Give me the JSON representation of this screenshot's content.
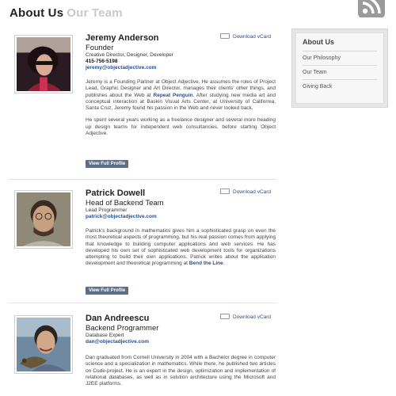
{
  "title": {
    "active": "About Us",
    "inactive": "Our Team"
  },
  "sidebar": {
    "heading": "About Us",
    "items": [
      {
        "label": "Our Philosophy"
      },
      {
        "label": "Our Team"
      },
      {
        "label": "Giving Back"
      }
    ]
  },
  "icons": {
    "rss": "rss-icon",
    "vcard": "vcard-icon"
  },
  "people": [
    {
      "name": "Jeremy Anderson",
      "role": "Founder",
      "subrole": "Creative Director, Designer, Developer",
      "phone": "415-756-5198",
      "email": "jeremy@objectadjective.com",
      "vcard": "Download vCard",
      "bio_p1_before": "Jeremy is a Founding Partner at Object Adjective. He assumes the roles of Project Lead, Graphic Designer and Art Director, manages their clients' other things, and publishes about the Web at ",
      "bio_p1_link": "Repeat Penguin",
      "bio_p1_after": ". After studying new media art and conceptual interaction at Baskin Visual Arts Center, at University of California, Santa Cruz, Jeremy found his passion in the Web and never looked back.",
      "bio_p2": "He spent several years working as a freelance designer and several more heading up design teams for independent web consultancies, before starting Object Adjective.",
      "button": "View Full Profile"
    },
    {
      "name": "Patrick Dowell",
      "role": "Head of Backend Team",
      "subrole": "Lead Programmer",
      "email": "patrick@objectadjective.com",
      "vcard": "Download vCard",
      "bio_p1_before": "Patrick's background in mathematics gives him a sophisticated grasp on even the most theoretical aspects of programming, but his real passion comes from applying that knowledge to building computer applications and web services. He has developed his own set of sophisticated web development tools for organizations attempting to build their own applications. Patrick writes about the application development and theoretical programming at ",
      "bio_p1_link": "Bend the Line",
      "bio_p1_after": ".",
      "button": "View Full Profile"
    },
    {
      "name": "Dan Andreescu",
      "role": "Backend Programmer",
      "subrole": "Database Expert",
      "email": "dan@objectadjective.com",
      "vcard": "Download vCard",
      "bio_p1": "Dan graduated from Cornell University in 2004 with a Bachelor degree in computer science and a specialization in mathematics. While there, he published two articles on Code-project. He is an expert in the design, optimization and implementation of relational databases, as well as in solution architecture using the Microsoft and J2EE platforms."
    }
  ]
}
